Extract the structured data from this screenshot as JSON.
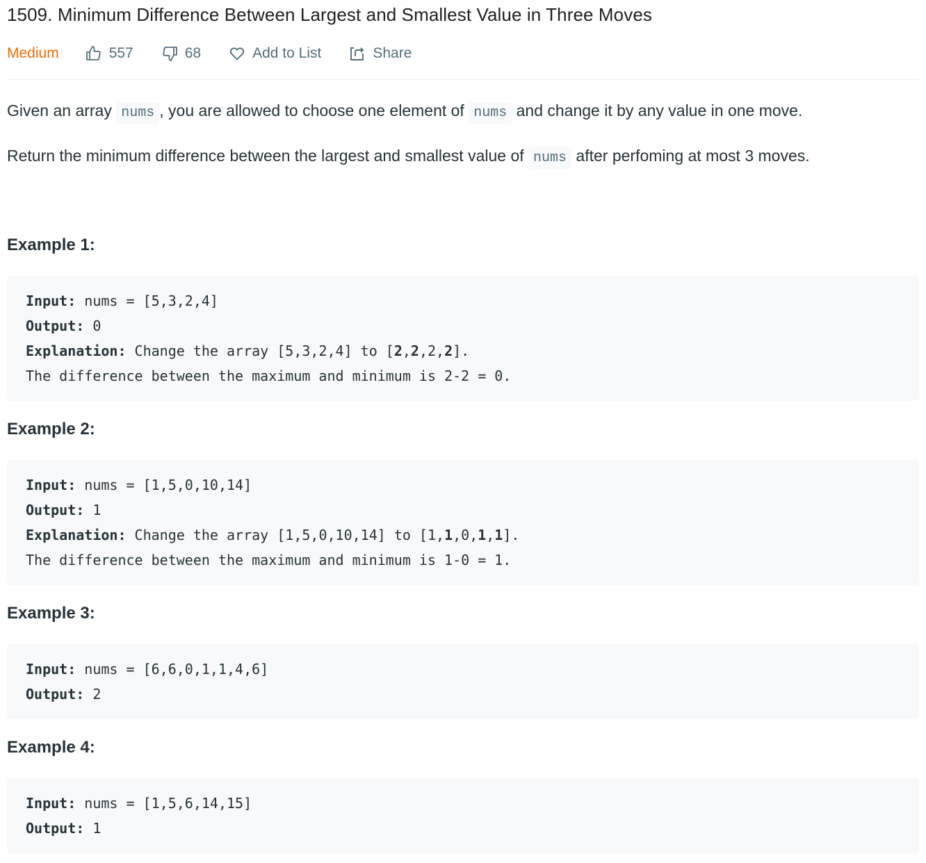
{
  "problem": {
    "title": "1509. Minimum Difference Between Largest and Smallest Value in Three Moves",
    "difficulty": "Medium",
    "difficulty_color": "#ef6c00",
    "likes": "557",
    "dislikes": "68",
    "add_to_list_label": "Add to List",
    "share_label": "Share"
  },
  "description": {
    "p1": {
      "before": "Given an array ",
      "code1": "nums",
      "middle": ", you are allowed to choose one element of ",
      "code2": "nums",
      "after": " and change it by any value in one move."
    },
    "p2": {
      "before": "Return the minimum difference between the largest and smallest value of ",
      "code": "nums",
      "after": " after perfoming at most 3 moves."
    }
  },
  "examples": [
    {
      "title": "Example 1:",
      "input_label": "Input:",
      "input_value": " nums = [5,3,2,4]",
      "output_label": "Output:",
      "output_value": " 0",
      "explanation_label": "Explanation:",
      "explanation_prefix": " Change the array [5,3,2,4] to [",
      "explanation_array": [
        {
          "v": "2",
          "bold": true
        },
        {
          "v": ",",
          "bold": false
        },
        {
          "v": "2",
          "bold": true
        },
        {
          "v": ",2,",
          "bold": false
        },
        {
          "v": "2",
          "bold": true
        }
      ],
      "explanation_suffix": "].",
      "explanation_line2": "The difference between the maximum and minimum is 2-2 = 0."
    },
    {
      "title": "Example 2:",
      "input_label": "Input:",
      "input_value": " nums = [1,5,0,10,14]",
      "output_label": "Output:",
      "output_value": " 1",
      "explanation_label": "Explanation:",
      "explanation_prefix": " Change the array [1,5,0,10,14] to [1,",
      "explanation_array": [
        {
          "v": "1",
          "bold": true
        },
        {
          "v": ",0,",
          "bold": false
        },
        {
          "v": "1",
          "bold": true
        },
        {
          "v": ",",
          "bold": false
        },
        {
          "v": "1",
          "bold": true
        }
      ],
      "explanation_suffix": "].",
      "explanation_line2": "The difference between the maximum and minimum is 1-0 = 1."
    },
    {
      "title": "Example 3:",
      "input_label": "Input:",
      "input_value": " nums = [6,6,0,1,1,4,6]",
      "output_label": "Output:",
      "output_value": " 2"
    },
    {
      "title": "Example 4:",
      "input_label": "Input:",
      "input_value": " nums = [1,5,6,14,15]",
      "output_label": "Output:",
      "output_value": " 1"
    }
  ],
  "icons": {
    "like": "thumbs-up-icon",
    "dislike": "thumbs-down-icon",
    "add_to_list": "heart-icon",
    "share": "share-icon"
  }
}
